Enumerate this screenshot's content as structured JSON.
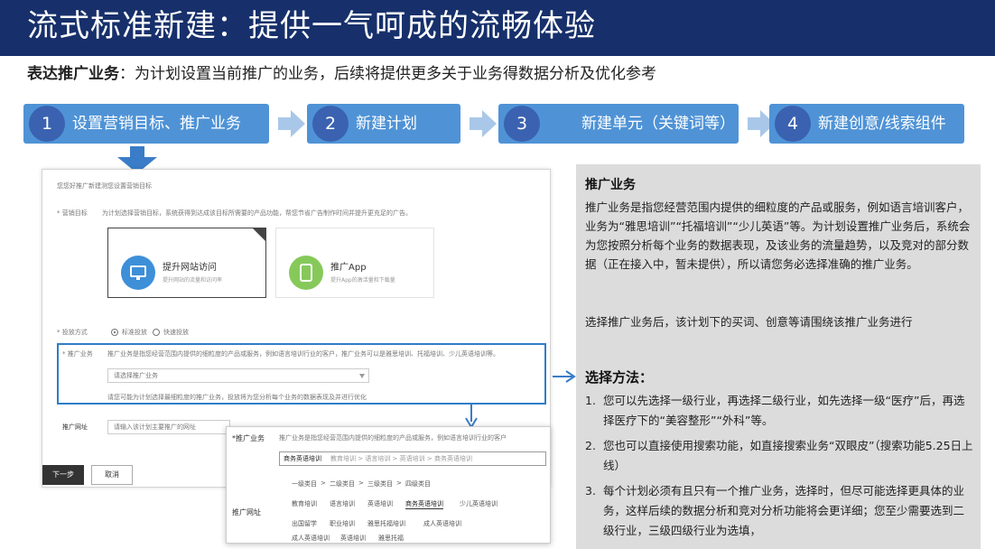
{
  "header": {
    "title": "流式标准新建：提供一气呵成的流畅体验"
  },
  "subtitle": {
    "bold": "表达推广业务",
    "rest": "：为计划设置当前推广的业务，后续将提供更多关于业务得数据分析及优化参考"
  },
  "steps": [
    {
      "num": "1",
      "label": "设置营销目标、推广业务"
    },
    {
      "num": "2",
      "label": "新建计划"
    },
    {
      "num": "3",
      "label": "新建单元（关键词等）"
    },
    {
      "num": "4",
      "label": "新建创意/线索组件"
    }
  ],
  "form": {
    "header_text": "您您好推广新建测您设置营销目标",
    "goal_label": "* 营销目标",
    "goal_desc": "为计划选择营销目标，系统获得到达成该目标所需要的产品功能，帮您节省广告制作时间并提升更充足的广告。",
    "card1_title": "提升网站访问",
    "card1_sub": "提升网站的流量和访问率",
    "card2_title": "推广App",
    "card2_sub": "提升App的激活量和下载量",
    "mode_label": "* 投放方式",
    "mode_opt1": "标准投放",
    "mode_opt2": "快速投放",
    "biz_label": "* 推广业务",
    "biz_desc": "推广业务是指您经营范围内提供的细粒度的产品或服务，例如语言培训行业的客户，推广业务可以是雅思培训、托福培训、少儿英语培训等。",
    "biz_placeholder": "请选择推广业务",
    "biz_hint": "请您可能为计划选择最细粒度的推广业务，投放将为您分析每个业务的数据表现及并进行优化",
    "site_label": "推广网址",
    "site_placeholder": "请输入该计划主要推广的网址",
    "btn_next": "下一步",
    "btn_cancel": "取消"
  },
  "dropdown": {
    "biz_label": "*推广业务",
    "biz_desc": "推广业务是指您经营范围内提供的细粒度的产品或服务，例如语言培训行业的客户",
    "selected": "商务英语培训",
    "path": "教育培训 > 语言培训 > 英语培训 > 商务英语培训",
    "site_label": "推广网址",
    "levels": [
      "一级类目",
      ">",
      "二级类目",
      ">",
      "三级类目",
      ">",
      "四级类目"
    ],
    "row1": [
      "教育培训",
      "语言培训",
      "英语培训",
      "商务英语培训",
      "少儿英语培训"
    ],
    "row2": [
      "出国留学",
      "职业培训",
      "雅思托福培训",
      "成人英语培训"
    ],
    "row3": [
      "成人英语培训",
      "英语培训",
      "雅思托福"
    ]
  },
  "info": {
    "title": "推广业务",
    "para1": "推广业务是指您经营范围内提供的细粒度的产品或服务，例如语言培训客户，业务为“雅思培训”“托福培训”“少儿英语”等。为计划设置推广业务后，系统会为您按照分析每个业务的数据表现，及该业务的流量趋势，以及竞对的部分数据（正在接入中，暂未提供），所以请您务必选择准确的推广业务。",
    "para2": "选择推广业务后，该计划下的买词、创意等请围绕该推广业务进行",
    "method_title": "选择方法：",
    "methods": [
      {
        "n": "1.",
        "text": "您可以先选择一级行业，再选择二级行业，如先选择一级“医疗”后，再选择医疗下的“美容整形”“外科”等。"
      },
      {
        "n": "2.",
        "text": "您也可以直接使用搜索功能，如直接搜索业务“双眼皮”（搜索功能5.25日上线）"
      },
      {
        "n": "3.",
        "text": "每个计划必须有且只有一个推广业务，选择时，但尽可能选择更具体的业务，这样后续的数据分析和竞对分析功能将会更详细；您至少需要选到二级行业，三级四级行业为选填，"
      }
    ]
  },
  "colors": {
    "title_bg": "#17306b",
    "step_bg": "#4f93d6",
    "step_circle": "#3a62b0",
    "chevron": "#a9c7e8",
    "highlight": "#2f7dc9",
    "info_bg": "#dcdcdc"
  },
  "icons": [
    "chevron-right-icon",
    "down-arrow-icon",
    "right-arrow-icon",
    "monitor-icon",
    "app-icon"
  ]
}
